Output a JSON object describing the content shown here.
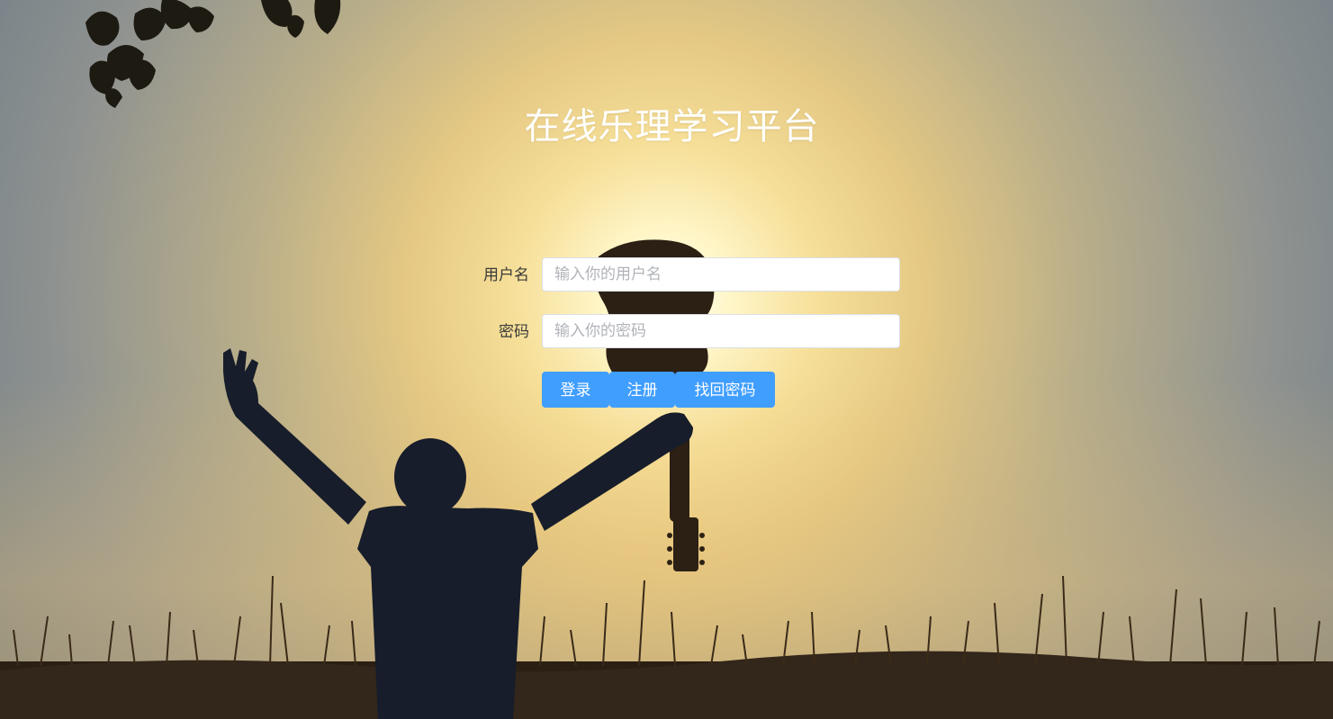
{
  "page": {
    "title": "在线乐理学习平台"
  },
  "form": {
    "username": {
      "label": "用户名",
      "placeholder": "输入你的用户名",
      "value": ""
    },
    "password": {
      "label": "密码",
      "placeholder": "输入你的密码",
      "value": ""
    }
  },
  "buttons": {
    "login": "登录",
    "register": "注册",
    "forgot": "找回密码"
  },
  "colors": {
    "primary_button": "#409eff",
    "title_text": "#ffffff",
    "label_text": "#3a3a3a"
  }
}
